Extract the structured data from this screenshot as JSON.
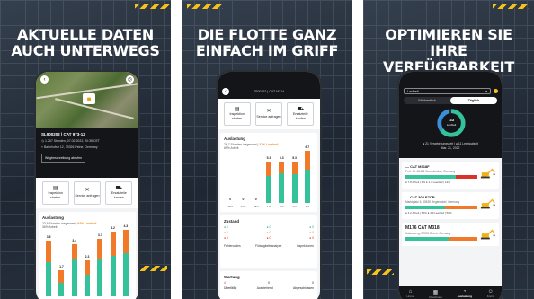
{
  "panels": [
    {
      "headline": [
        "AKTUELLE DATEN",
        "AUCH UNTERWEGS"
      ],
      "machine": "SL900202 | CAT 973-12",
      "hours": "1.257 Stunden, 07.02.2022, 20:35 CET",
      "address": "Bahnhofstr 12, 39326 Peine, Germany",
      "route_button": "Wegbeschreibung abrufen",
      "actions": [
        {
          "icon": "document-icon",
          "glyph": "▤",
          "label": "Inspektion starten"
        },
        {
          "icon": "wrench-icon",
          "glyph": "✕",
          "label": "Service anfragen"
        },
        {
          "icon": "cart-icon",
          "glyph": "⛟",
          "label": "Ersatzteile kaufen"
        }
      ],
      "usage_title": "Auslastung",
      "usage_summary": "23,6 Stunden insgesamt",
      "usage_idle": "64% Leerlauf",
      "usage_work": "36% Arbeit"
    },
    {
      "headline": [
        "DIE FLOTTE GANZ",
        "EINFACH IM GRIFF"
      ],
      "topbar": "ZS00162 | CAT M314",
      "actions": [
        {
          "icon": "document-icon",
          "glyph": "▤",
          "label": "Inspektion starten"
        },
        {
          "icon": "wrench-icon",
          "glyph": "✕",
          "label": "Service anfragen"
        },
        {
          "icon": "cart-icon",
          "glyph": "⛟",
          "label": "Ersatzteile kaufen"
        }
      ],
      "usage_title": "Auslastung",
      "usage_summary": "26,7 Stunden insgesamt",
      "usage_idle": "31% Leerlauf",
      "usage_work": "69% Arbeit",
      "state_title": "Zustand",
      "state_rows": [
        [
          "● 0",
          "● 0",
          "● 0"
        ],
        [
          "● 0",
          "● 0",
          "● 0"
        ],
        [
          "● 0",
          "● 0",
          "● 0"
        ]
      ],
      "state_cols": [
        "Fehlercodes",
        "Flüssigkeitsanalyse",
        "Inspektionen"
      ],
      "maint_title": "Wartung",
      "maint_values": [
        "4",
        "0",
        "0"
      ],
      "maint_labels": [
        "Überfällig",
        "Ausstehend",
        "Abgeschlossen"
      ]
    },
    {
      "headline": [
        "OPTIMIEREN SIE",
        "IHRE VERFÜGBARKEIT"
      ],
      "select_value": "Laufzeit",
      "seg": [
        "Wöchentlich",
        "Täglich"
      ],
      "donut_value": "-33",
      "donut_label": "Laufzeit",
      "legend": "● 21 Verarbeitungszeit | ● 11 Leerlaufzeit",
      "date": "Mar. 21, 2022",
      "machines": [
        {
          "name": "— CAT M318F",
          "addr": "Prof. St. 45406 Gemnkeldorf, Germany",
          "value": "9.1",
          "stats": "● 7.8 Arbeit | 4% ● 1.3 Leerlauf | 14%"
        },
        {
          "name": "— CAT 305 E7CR",
          "addr": "Marktplatz 5, 30539 Regensdorf, Germany",
          "value": "8.5",
          "stats": "● 4.2 Arbeit | 50% ● 4.3 Leerlauf | 50%"
        },
        {
          "name": "M176 CAT M318",
          "addr": "Kakuswerg, 57394 Bruch, Germany",
          "value": "",
          "stats": ""
        }
      ],
      "nav": [
        "Home",
        "Maschinen",
        "Auslastung",
        "Konto"
      ]
    }
  ],
  "chart_data": [
    {
      "type": "bar",
      "categories": [
        "1/3",
        "2/3",
        "3/3",
        "4/3",
        "5/3",
        "6/3",
        "7/3"
      ],
      "series": [
        {
          "name": "Leerlauf",
          "values": [
            1.4,
            0.8,
            1.0,
            0.9,
            1.3,
            1.6,
            1.5
          ]
        },
        {
          "name": "Arbeit",
          "values": [
            2.2,
            0.9,
            2.4,
            1.4,
            2.4,
            2.6,
            2.8
          ]
        }
      ],
      "totals": [
        "3.6",
        "1.7",
        "3.4",
        "2.3",
        "3.7",
        "4.2",
        "4.3"
      ]
    },
    {
      "type": "bar",
      "categories": [
        "26/2",
        "27/2",
        "28/2",
        "1/3",
        "2/3",
        "3/3",
        "4/3"
      ],
      "series": [
        {
          "name": "Leerlauf",
          "values": [
            0,
            0,
            0,
            1.8,
            1.5,
            1.6,
            2.4
          ]
        },
        {
          "name": "Arbeit",
          "values": [
            0,
            0,
            0,
            3.5,
            3.8,
            3.7,
            4.3
          ]
        }
      ],
      "totals": [
        "0",
        "0",
        "0",
        "5.3",
        "5.3",
        "5.3",
        "6.7"
      ]
    }
  ],
  "colors": {
    "accent": "#f6c21a",
    "work": "#34c29a",
    "idle": "#f07a2a",
    "danger": "#d9342b"
  }
}
